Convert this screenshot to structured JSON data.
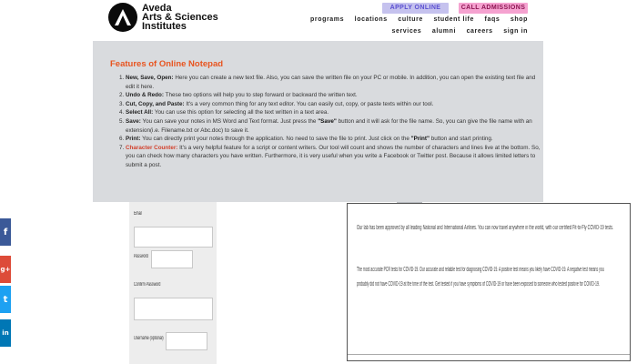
{
  "brand": {
    "line1": "Aveda",
    "line2": "Arts & Sciences",
    "line3": "Institutes"
  },
  "header": {
    "apply_label": "APPLY ONLINE",
    "call_label": "CALL ADMISSIONS",
    "nav_primary": [
      "programs",
      "locations",
      "culture",
      "student life",
      "faqs",
      "shop"
    ],
    "nav_secondary": [
      "services",
      "alumni",
      "careers",
      "sign in"
    ]
  },
  "features": {
    "title": "Features of Online Notepad",
    "items": [
      {
        "term": "New, Save, Open:",
        "text": " Here you can create a new text file. Also, you can save the written file on your PC or mobile. In addition, you can open the existing text file and edit it here."
      },
      {
        "term": "Undo & Redo:",
        "text": " These two options will help you to step forward or backward the written text."
      },
      {
        "term": "Cut, Copy, and Paste:",
        "text": " It's a very common thing for any text editor. You can easily cut, copy, or paste texts within our tool."
      },
      {
        "term": "Select All:",
        "text": " You can use this option for selecting all the text written in a text area."
      },
      {
        "term": "Save:",
        "text_a": " You can save your notes in MS Word and Text format. Just press the ",
        "quote": "\"Save\"",
        "text_b": " button and it will ask for the file name. So, you can give the file name with an extension(i.e. Filename.txt or Abc.doc) to save it."
      },
      {
        "term": "Print:",
        "text_a": " You can directly print your notes through the application. No need to save the file to print. Just click on the ",
        "quote": "\"Print\"",
        "text_b": " button and start printing."
      },
      {
        "term": "Character Counter:",
        "text": " It's a very helpful feature for a script or content writers. Our tool will count and shows the number of characters and lines live at the bottom. So, you can check how many characters you have written. Furthermore, it is very useful when you write a Facebook or Twitter post. Because it allows limited letters to submit a post."
      }
    ]
  },
  "form": {
    "label_email": "Email",
    "label_password": "Password",
    "label_confirm": "Confirm Password",
    "label_username": "Username (optional)"
  },
  "doc": {
    "line1": "Our lab has been approved by all leading National and International Airlines. You can now travel anywhere in the world, with our certified Fit-to-Fly COVID-19 tests.",
    "line2": "The most accurate PCR tests for COVID-19. Our accurate and reliable test for diagnosing COVID-19. A positive test means you likely have COVID-19. A negative test means you",
    "line3": "probably did not have COVID-19 at the time of the test. Get tested if you have symptoms of COVID-19 or have been exposed to someone who tested positive for COVID-19."
  },
  "social": {
    "facebook_glyph": "f",
    "gplus_glyph": "g+",
    "twitter_glyph": "t",
    "linkedin_glyph": "in",
    "colors": {
      "facebook": "#3b5998",
      "gplus": "#dd4b39",
      "twitter": "#1da1f2",
      "linkedin": "#0077b5"
    }
  }
}
